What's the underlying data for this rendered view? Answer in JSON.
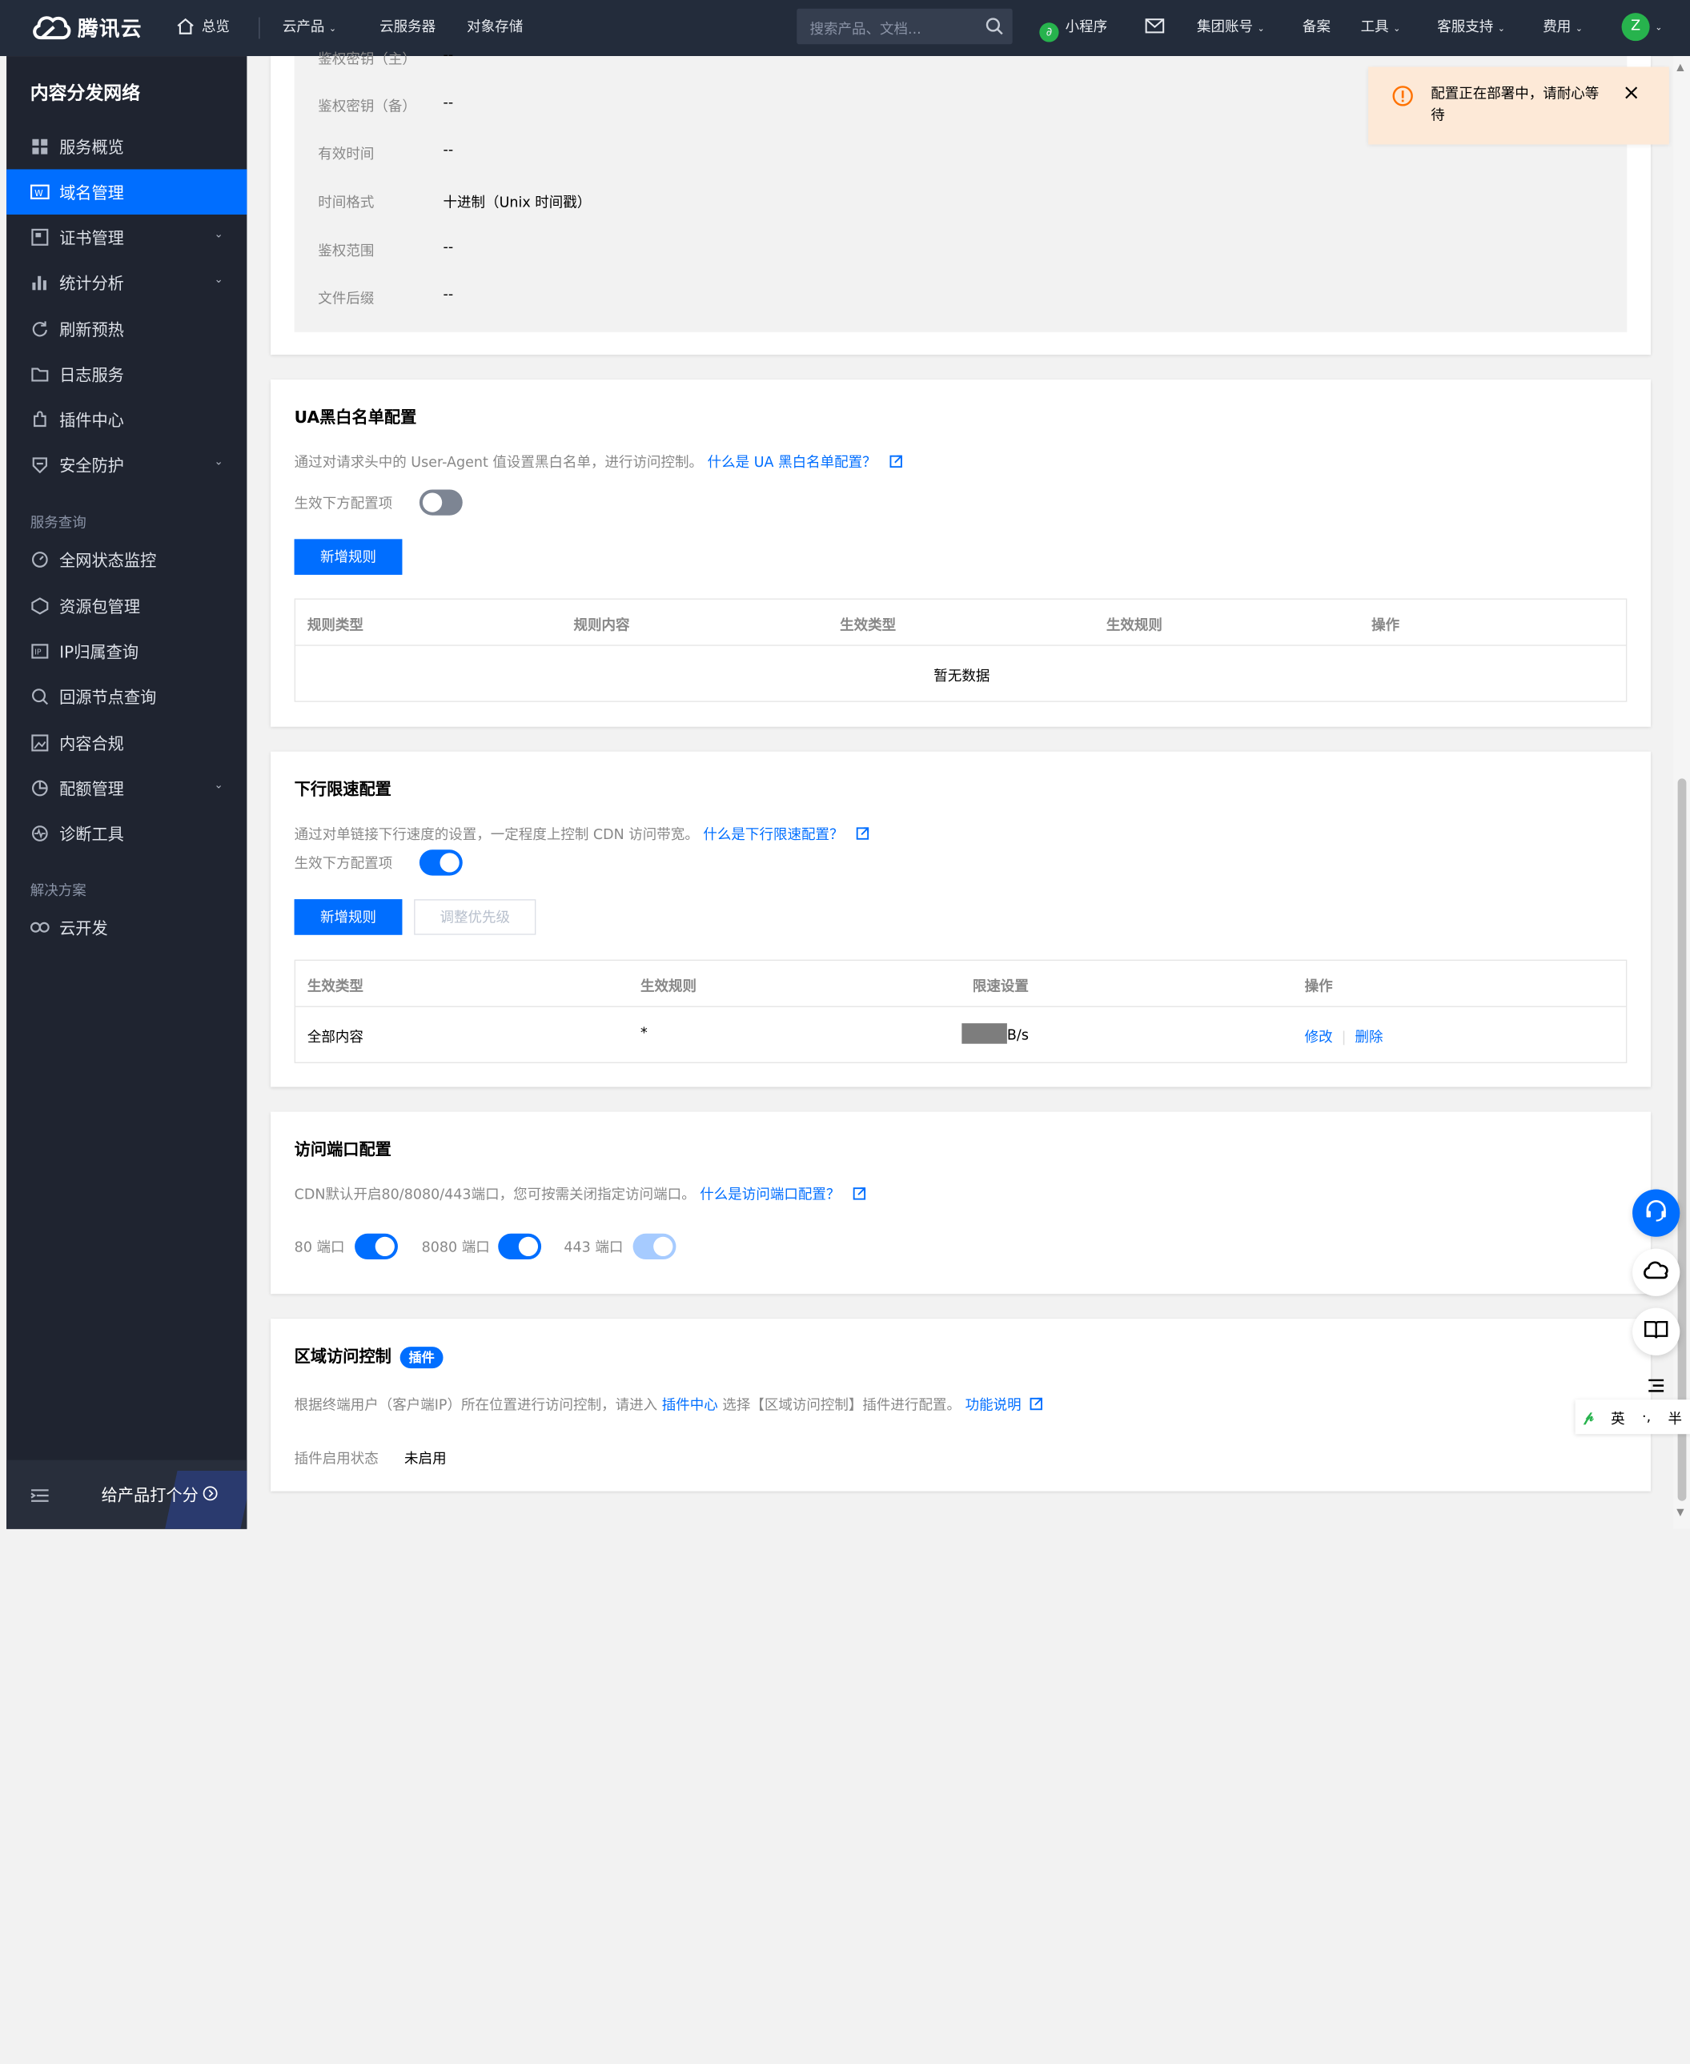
{
  "topbar": {
    "brand": "腾讯云",
    "overview": "总览",
    "products": "云产品",
    "cvm": "云服务器",
    "cos": "对象存储",
    "search_placeholder": "搜索产品、文档...",
    "miniprogram": "小程序",
    "group_account": "集团账号",
    "beian": "备案",
    "tools": "工具",
    "support": "客服支持",
    "billing": "费用",
    "avatar_letter": "Z"
  },
  "sidebar": {
    "title": "内容分发网络",
    "items": [
      {
        "label": "服务概览",
        "icon": "grid-icon"
      },
      {
        "label": "域名管理",
        "icon": "domain-icon",
        "active": true
      },
      {
        "label": "证书管理",
        "icon": "certificate-icon",
        "expandable": true
      },
      {
        "label": "统计分析",
        "icon": "bar-chart-icon",
        "expandable": true
      },
      {
        "label": "刷新预热",
        "icon": "refresh-icon"
      },
      {
        "label": "日志服务",
        "icon": "folder-icon"
      },
      {
        "label": "插件中心",
        "icon": "plugin-icon"
      },
      {
        "label": "安全防护",
        "icon": "shield-icon",
        "expandable": true
      }
    ],
    "group_query": "服务查询",
    "query_items": [
      {
        "label": "全网状态监控",
        "icon": "monitor-icon"
      },
      {
        "label": "资源包管理",
        "icon": "package-icon"
      },
      {
        "label": "IP归属查询",
        "icon": "ip-icon"
      },
      {
        "label": "回源节点查询",
        "icon": "search-node-icon"
      },
      {
        "label": "内容合规",
        "icon": "image-icon"
      },
      {
        "label": "配额管理",
        "icon": "quota-icon",
        "expandable": true
      },
      {
        "label": "诊断工具",
        "icon": "diagnose-icon"
      }
    ],
    "group_solution": "解决方案",
    "solution_items": [
      {
        "label": "云开发",
        "icon": "cloud-dev-icon"
      }
    ],
    "rate_label": "给产品打个分"
  },
  "auth_info": {
    "rows": [
      {
        "label": "鉴权密钥（主）",
        "value": "--"
      },
      {
        "label": "鉴权密钥（备）",
        "value": "--"
      },
      {
        "label": "有效时间",
        "value": "--"
      },
      {
        "label": "时间格式",
        "value": "十进制（Unix 时间戳）"
      },
      {
        "label": "鉴权范围",
        "value": "--"
      },
      {
        "label": "文件后缀",
        "value": "--"
      }
    ]
  },
  "ua": {
    "title": "UA黑白名单配置",
    "desc": "通过对请求头中的 User-Agent 值设置黑白名单，进行访问控制。",
    "link": "什么是 UA 黑白名单配置？",
    "enable_label": "生效下方配置项",
    "enabled": false,
    "add_button": "新增规则",
    "columns": [
      "规则类型",
      "规则内容",
      "生效类型",
      "生效规则",
      "操作"
    ],
    "empty": "暂无数据"
  },
  "speed": {
    "title": "下行限速配置",
    "desc": "通过对单链接下行速度的设置，一定程度上控制 CDN 访问带宽。",
    "link": "什么是下行限速配置？",
    "enable_label": "生效下方配置项",
    "enabled": true,
    "add_button": "新增规则",
    "priority_button": "调整优先级",
    "columns": [
      "生效类型",
      "生效规则",
      "限速设置",
      "操作"
    ],
    "rows": [
      {
        "type": "全部内容",
        "rule": "*",
        "limit_unit": "B/s",
        "edit": "修改",
        "delete": "删除"
      }
    ]
  },
  "ports": {
    "title": "访问端口配置",
    "desc": "CDN默认开启80/8080/443端口，您可按需关闭指定访问端口。",
    "link": "什么是访问端口配置？",
    "items": [
      {
        "label": "80 端口",
        "enabled": true
      },
      {
        "label": "8080 端口",
        "enabled": true
      },
      {
        "label": "443 端口",
        "enabled": true,
        "disabled": true
      }
    ]
  },
  "region": {
    "title": "区域访问控制",
    "badge": "插件",
    "desc_prefix": "根据终端用户（客户端IP）所在位置进行访问控制，请进入",
    "plugin_link": "插件中心",
    "desc_suffix": "选择【区域访问控制】插件进行配置。",
    "doc_link": "功能说明",
    "status_label": "插件启用状态",
    "status_value": "未启用"
  },
  "toast": {
    "message": "配置正在部署中，请耐心等待"
  },
  "ime": {
    "lang": "英",
    "punct": "·,",
    "width": "半"
  },
  "colors": {
    "accent": "#006eff",
    "sidebar_bg": "#1f2430",
    "topbar_bg": "#232c3b",
    "warning": "#ff7200"
  }
}
